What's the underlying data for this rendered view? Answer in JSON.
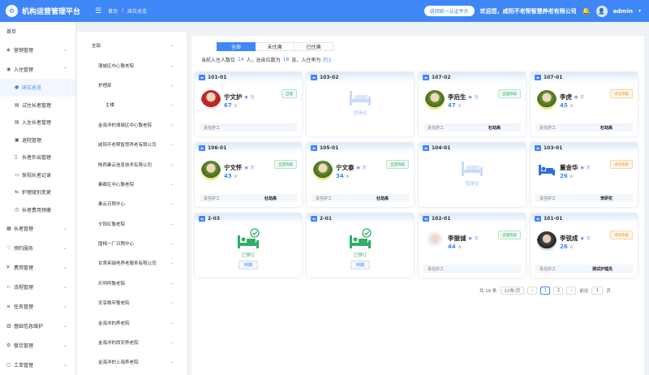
{
  "header": {
    "title": "机构运营管理平台",
    "breadcrumb": [
      "首页",
      "/",
      "床位总览"
    ],
    "return_label": "返回统一认证平台",
    "welcome": "欢迎您，咸阳不老帮智慧养老有限公司",
    "user": "admin",
    "brand_color": "#3f87f6"
  },
  "sidebar": {
    "home": "首页",
    "items": [
      {
        "label": "营销管理",
        "icon": "megaphone-icon"
      },
      {
        "label": "入住管理",
        "icon": "person-icon"
      },
      {
        "label": "床位总览",
        "icon": "dot-icon"
      },
      {
        "label": "试住长者管理",
        "icon": "doc-icon"
      },
      {
        "label": "入住长者管理",
        "icon": "doc-icon"
      },
      {
        "label": "退院管理",
        "icon": "exit-icon"
      },
      {
        "label": "长者外出管理",
        "icon": "door-icon"
      },
      {
        "label": "探视长者记录",
        "icon": "monitor-icon"
      },
      {
        "label": "护理级别变更",
        "icon": "swap-icon"
      },
      {
        "label": "长者费用预缴",
        "icon": "clock-icon"
      },
      {
        "label": "长者管理",
        "icon": "folder-icon"
      },
      {
        "label": "预约服务",
        "icon": "heart-icon"
      },
      {
        "label": "费用管理",
        "icon": "money-icon"
      },
      {
        "label": "流程管理",
        "icon": "code-icon"
      },
      {
        "label": "任务管理",
        "icon": "list-icon"
      },
      {
        "label": "基础信息维护",
        "icon": "chart-icon"
      },
      {
        "label": "餐饮管理",
        "icon": "gear-icon"
      },
      {
        "label": "工单管理",
        "icon": "ticket-icon"
      }
    ]
  },
  "tree": [
    "全部",
    "渭城区中心敬老院",
    "护理部",
    "主楼",
    "金海洋的渭城区中心敬老院",
    "咸阳不老帮智慧养老有限公司",
    "陕西秦云信息技术有限公司",
    "秦都区中心敬老院",
    "秦云日照中心",
    "夕阳红敬老院",
    "国棉一厂日照中心",
    "甘肃英瑞地养老服务有限公司",
    "乐呵呵敬老院",
    "安享晚年敬老院",
    "金海洋的养老院",
    "金海洋的西安养老院",
    "金海洋的上海养老院"
  ],
  "tabs": [
    "全部",
    "未住满",
    "已住满"
  ],
  "stats": {
    "p1": "当前入住人数位",
    "n1": "14",
    "p2": "人，总床位数为",
    "n2": "18",
    "p3": "张，入住率为",
    "n3": "约3"
  },
  "cards": [
    {
      "room": "101-01",
      "type": "person",
      "name": "宁文护",
      "grade": "普",
      "age": "67",
      "unit": "岁",
      "tag": "自理",
      "tag_color": "green",
      "photo": "red",
      "staff_label": "责任护工",
      "staff": ""
    },
    {
      "room": "103-02",
      "type": "empty",
      "empty_text": "空床位"
    },
    {
      "room": "107-02",
      "type": "person",
      "name": "李后生",
      "grade": "普",
      "age": "47",
      "unit": "岁",
      "tag": "自理等级",
      "tag_color": "green",
      "photo": "green",
      "staff_label": "责任护工",
      "staff": "杜劫高"
    },
    {
      "room": "107-01",
      "type": "person",
      "name": "李虎",
      "grade": "普",
      "age": "45",
      "unit": "岁",
      "tag": "试住等级",
      "tag_color": "orange",
      "photo": "green",
      "staff_label": "责任护工",
      "staff": "杜劫高"
    },
    {
      "room": "106-01",
      "type": "person",
      "name": "宁文怀",
      "grade": "普",
      "age": "43",
      "unit": "岁",
      "tag": "自理等级",
      "tag_color": "green",
      "photo": "green",
      "staff_label": "责任护工",
      "staff": "杜劫高"
    },
    {
      "room": "105-01",
      "type": "person",
      "name": "宁文泰",
      "grade": "普",
      "age": "34",
      "unit": "岁",
      "tag": "自理等级",
      "tag_color": "green",
      "photo": "green",
      "staff_label": "责任护工",
      "staff": "杜劫高"
    },
    {
      "room": "104-01",
      "type": "empty",
      "empty_text": "空床位"
    },
    {
      "room": "103-01",
      "type": "sleep",
      "name": "董金华",
      "grade": "普",
      "age": "26",
      "unit": "岁",
      "tag": "试住等级",
      "tag_color": "orange",
      "staff_label": "责任护工",
      "staff": "李研花"
    },
    {
      "room": "2-03",
      "type": "booked",
      "booked_text": "已预订",
      "cancel": "到期"
    },
    {
      "room": "2-01",
      "type": "booked",
      "booked_text": "已预订",
      "cancel": "到期"
    },
    {
      "room": "102-01",
      "type": "person",
      "name": "李振诚",
      "grade": "普",
      "age": "44",
      "unit": "岁",
      "tag": "自理等级",
      "tag_color": "green",
      "photo": "white",
      "staff_label": "责任护工",
      "staff": ""
    },
    {
      "room": "101-01",
      "type": "person",
      "name": "李锐成",
      "grade": "普",
      "age": "26",
      "unit": "岁",
      "tag": "试住等级",
      "tag_color": "orange",
      "photo": "dark",
      "staff_label": "责任护工",
      "staff": "测试护理员"
    }
  ],
  "pager": {
    "total": "共 16 条",
    "size": "12条/页",
    "prev": "‹",
    "pages": [
      "1",
      "2"
    ],
    "next": "›",
    "goto": "前往",
    "goto_value": "1",
    "page_unit": "页"
  }
}
